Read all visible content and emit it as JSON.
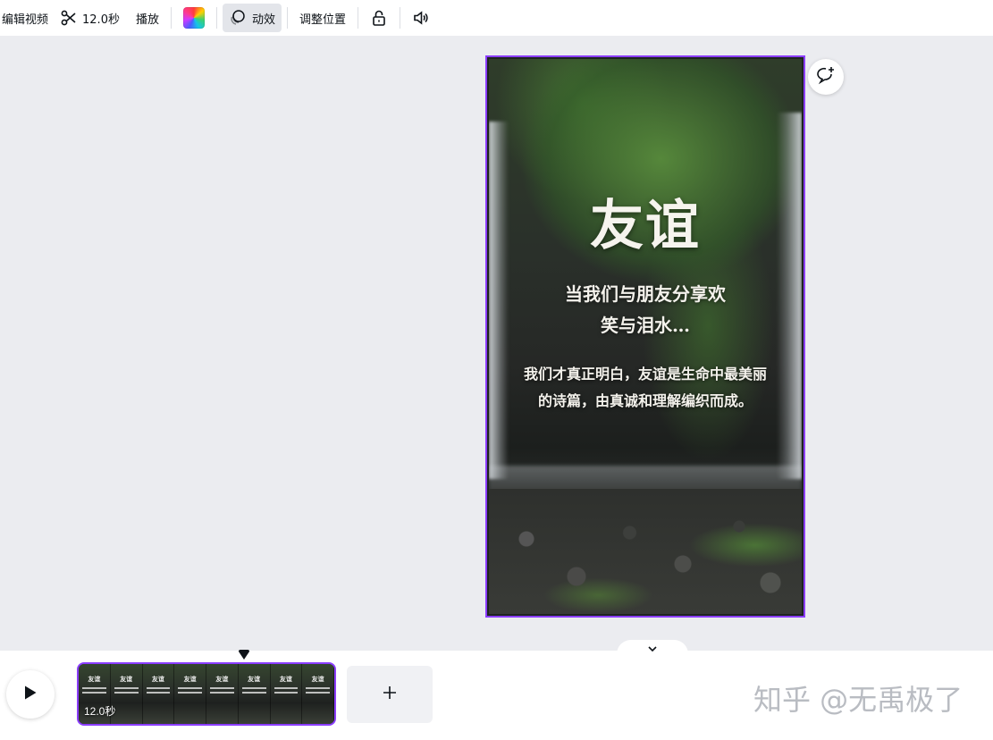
{
  "toolbar": {
    "edit_video_label": "编辑视频",
    "duration_label": "12.0秒",
    "play_label": "播放",
    "animate_label": "动效",
    "position_label": "调整位置"
  },
  "video": {
    "title": "友谊",
    "subtitle_line1": "当我们与朋友分享欢",
    "subtitle_line2": "笑与泪水…",
    "body_line1": "我们才真正明白，友谊是生命中最美丽",
    "body_line2": "的诗篇，由真诚和理解编织而成。"
  },
  "timeline": {
    "clip_duration": "12.0秒",
    "clip_frame_title": "友谊",
    "clip_frame_count": 8
  },
  "watermark": "知乎 @无禹极了",
  "colors": {
    "accent": "#8b3dff",
    "toolbar_bg": "#ffffff",
    "canvas_bg": "#ebecf0"
  },
  "icons": {
    "scissors": "scissors-icon",
    "color": "color-palette-icon",
    "animate": "animate-icon",
    "lock": "unlock-icon",
    "volume": "volume-icon",
    "comment": "add-comment-icon",
    "play": "play-icon",
    "add": "plus-icon",
    "collapse": "chevron-down-icon"
  }
}
